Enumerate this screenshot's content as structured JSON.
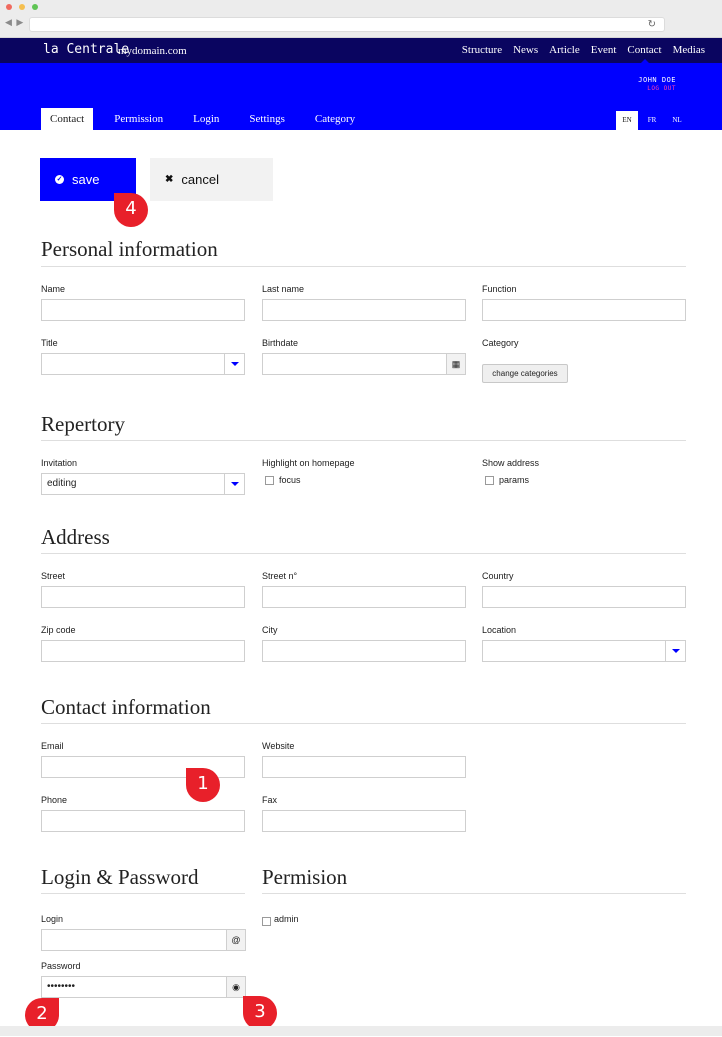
{
  "browser": {
    "nav_arrows": "◀ ▶",
    "reload_icon": "refresh-icon"
  },
  "header": {
    "brand": "la Centrale",
    "domain": "mydomain.com",
    "nav": [
      "Structure",
      "News",
      "Article",
      "Event",
      "Contact",
      "Medias"
    ],
    "active_nav": "Contact",
    "user": "JOHN DOE",
    "logout": "LOG OUT"
  },
  "tabs": [
    "Contact",
    "Permission",
    "Login",
    "Settings",
    "Category"
  ],
  "active_tab": "Contact",
  "languages": [
    "EN",
    "FR",
    "NL"
  ],
  "active_language": "EN",
  "actions": {
    "save": "save",
    "cancel": "cancel"
  },
  "markers": [
    "1",
    "2",
    "3",
    "4"
  ],
  "sections": {
    "personal": {
      "title": "Personal information",
      "name": "Name",
      "last_name": "Last name",
      "function": "Function",
      "title_field": "Title",
      "birthdate": "Birthdate",
      "category": "Category",
      "change_categories": "change categories"
    },
    "repertory": {
      "title": "Repertory",
      "invitation": "Invitation",
      "invitation_value": "editing",
      "highlight": "Highlight on homepage",
      "focus": "focus",
      "show_address": "Show address",
      "params": "params"
    },
    "address": {
      "title": "Address",
      "street": "Street",
      "street_no": "Street n°",
      "country": "Country",
      "zip": "Zip code",
      "city": "City",
      "location": "Location"
    },
    "contact": {
      "title": "Contact information",
      "email": "Email",
      "website": "Website",
      "phone": "Phone",
      "fax": "Fax"
    },
    "login": {
      "title": "Login & Password",
      "login": "Login",
      "password": "Password",
      "password_value": "••••••••",
      "at_symbol": "@"
    },
    "permission": {
      "title": "Permision",
      "admin": "admin"
    }
  },
  "colors": {
    "navy": "#0a0560",
    "blue": "#0000ff",
    "marker_red": "#e8202a",
    "logout_pink": "#ff3fb0"
  }
}
